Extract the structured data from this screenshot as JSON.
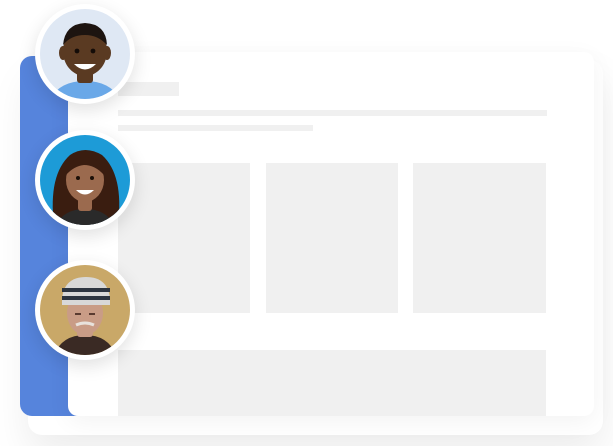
{
  "colors": {
    "accent": "#5684dc",
    "panel": "#ffffff",
    "placeholder": "#f0f0f0"
  },
  "avatars": [
    {
      "name": "avatar-child-icon",
      "bg": "#dfe8f4",
      "skin": "#5a3a22",
      "hair": "#1d1410",
      "shirt": "#6aa8e8"
    },
    {
      "name": "avatar-woman-icon",
      "bg": "#1d9bd7",
      "skin": "#9b6a4e",
      "hair": "#3a1d10",
      "shirt": "#2a2a2a"
    },
    {
      "name": "avatar-elder-icon",
      "bg": "#c9a868",
      "skin": "#c99c86",
      "hair": "#d8d8d8",
      "shirt": "#3a2a24"
    }
  ]
}
